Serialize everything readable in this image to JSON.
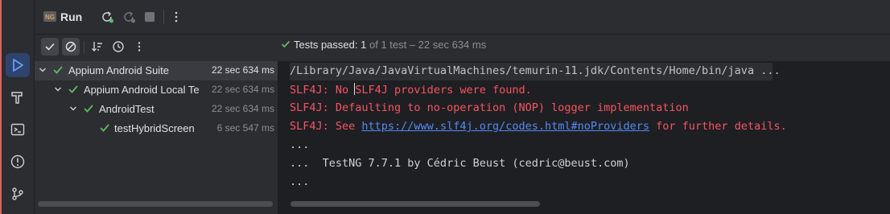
{
  "panel": {
    "title": "Run",
    "tab_badge": "NG"
  },
  "status": {
    "passed_label": "Tests passed:",
    "passed_count": "1",
    "rest": "of 1 test – 22 sec 634 ms"
  },
  "tree": [
    {
      "label": "Appium Android Suite",
      "time": "22 sec 634 ms"
    },
    {
      "label": "Appium Android Local Te",
      "time": "22 sec 634 ms"
    },
    {
      "label": "AndroidTest",
      "time": "22 sec 634 ms"
    },
    {
      "label": "testHybridScreen",
      "time": "6 sec 547 ms"
    }
  ],
  "console": {
    "cmd": "/Library/Java/JavaVirtualMachines/temurin-11.jdk/Contents/Home/bin/java ...",
    "line1_a": "SLF4J: No ",
    "line1_b": "SLF4J providers were found.",
    "line2": "SLF4J: Defaulting to no-operation (NOP) logger implementation",
    "line3_prefix": "SLF4J: See ",
    "line3_link": "https://www.slf4j.org/codes.html#noProviders",
    "line3_suffix": " for further details.",
    "line4": "...",
    "line5": "...  TestNG 7.7.1 by Cédric Beust (cedric@beust.com)",
    "line6": "..."
  },
  "colors": {
    "accent": "#548af7",
    "error": "#f75464",
    "success": "#5fb865"
  },
  "icons": [
    "run-icon",
    "build-icon",
    "terminal-icon",
    "problems-icon",
    "git-icon",
    "rerun-icon",
    "rerun-failed-icon",
    "stop-icon",
    "more-icon",
    "check-icon",
    "stop-filter-icon",
    "sort-icon",
    "clock-icon"
  ]
}
